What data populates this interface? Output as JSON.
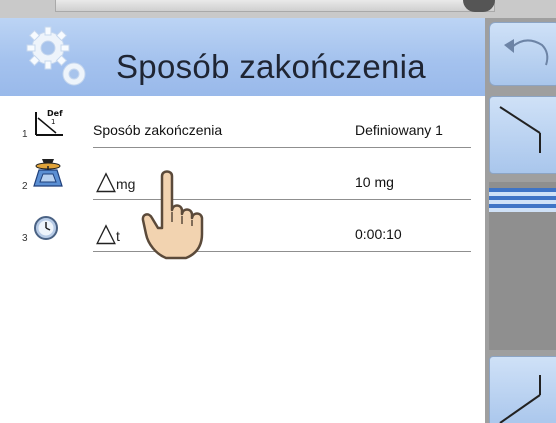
{
  "header": {
    "title": "Sposób zakończenia"
  },
  "rows": [
    {
      "number": "1",
      "label": "Sposób zakończenia",
      "value": "Definiowany 1",
      "icon": "def-slope-icon"
    },
    {
      "number": "2",
      "label_symbol": "△",
      "label_sub": "mg",
      "value": "10 mg",
      "icon": "weight-icon"
    },
    {
      "number": "3",
      "label_symbol": "△",
      "label_sub": "t",
      "value": "0:00:10",
      "icon": "clock-icon"
    }
  ],
  "icons": {
    "header": "gears-icon",
    "back": "back-arrow-icon",
    "up": "scroll-up-icon",
    "down": "scroll-down-icon",
    "pointer": "hand-pointer-icon"
  },
  "colors": {
    "header_top": "#bcd4f4",
    "header_bottom": "#99b9ea",
    "panel": "#9f9f9f",
    "scroll_thumb": "#3f74c6"
  }
}
